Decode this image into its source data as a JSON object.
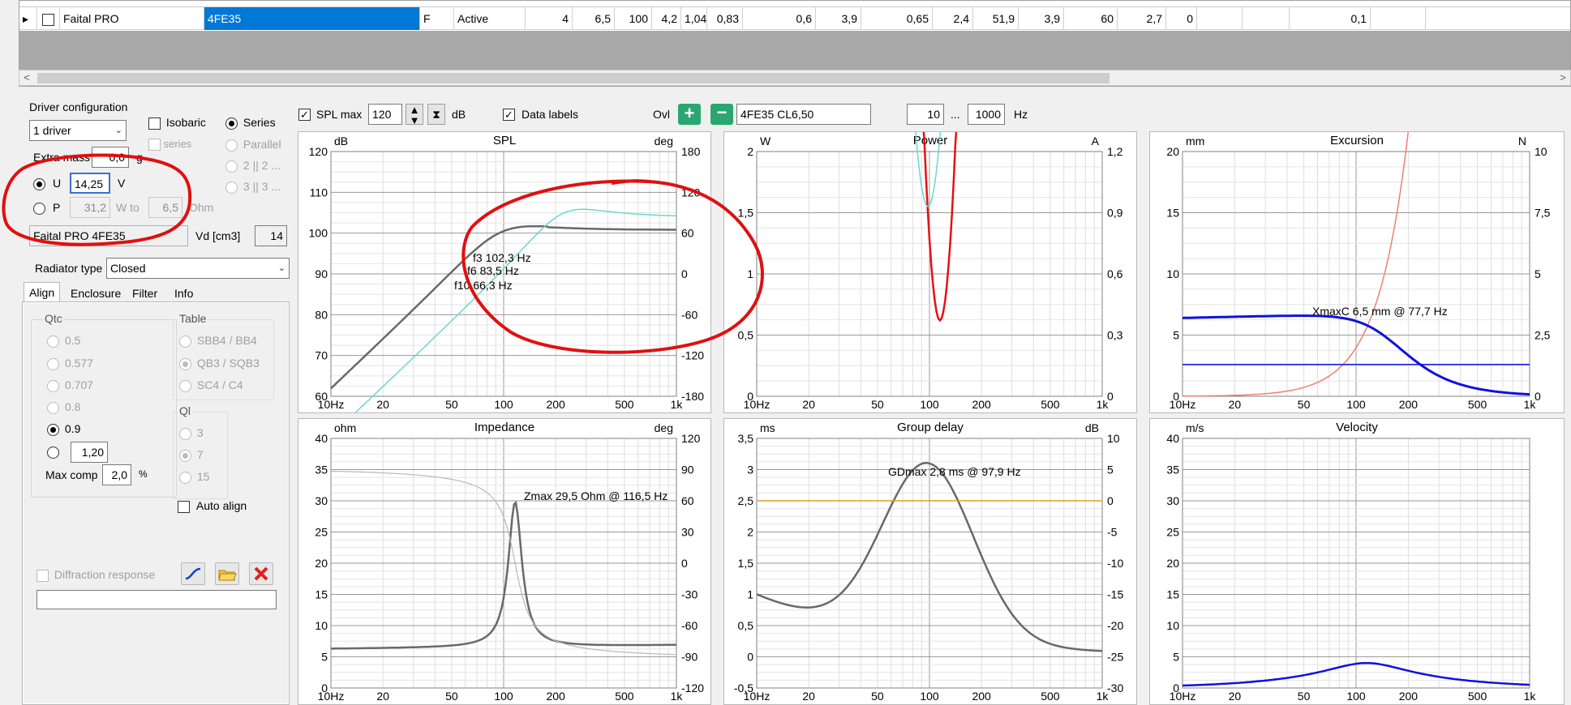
{
  "table": {
    "row": {
      "manufacturer": "Faital PRO",
      "model": "4FE35",
      "type": "F",
      "status": "Active",
      "values": [
        "4",
        "6,5",
        "100",
        "4,2",
        "1,04",
        "0,83",
        "0,6",
        "3,9",
        "0,65",
        "2,4",
        "51,9",
        "3,9",
        "60",
        "2,7",
        "0",
        "",
        "",
        "0,1",
        ""
      ]
    },
    "scroll_left": "<",
    "scroll_right": ">"
  },
  "driver_config": {
    "title": "Driver configuration",
    "count": "1 driver",
    "isobaric": "Isobaric",
    "series": "Series",
    "parallel": "Parallel",
    "series_small": "series",
    "opt22": "2 || 2 ...",
    "opt33": "3 || 3 ...",
    "extra_mass_label": "Extra mass",
    "extra_mass": "0,0",
    "extra_mass_unit": "g",
    "u_label": "U",
    "u_value": "14,25",
    "u_unit": "V",
    "p_label": "P",
    "p_value": "31,2",
    "p_unit": "W to",
    "ohm_value": "6,5",
    "ohm_unit": "Ohm",
    "driver_name": "Faital PRO 4FE35",
    "vd_label": "Vd [cm3]",
    "vd_value": "14"
  },
  "radiator": {
    "label": "Radiator type",
    "value": "Closed"
  },
  "tabs": [
    "Align",
    "Enclosure",
    "Filter",
    "Info"
  ],
  "align": {
    "qtc_title": "Qtc",
    "qtc_options": [
      "0.5",
      "0.577",
      "0.707",
      "0.8",
      "0.9"
    ],
    "qtc_custom": "1,20",
    "max_comp_label": "Max comp",
    "max_comp": "2,0",
    "max_comp_unit": "%",
    "table_title": "Table",
    "table_options": [
      "SBB4 / BB4",
      "QB3 / SQB3",
      "SC4 / C4"
    ],
    "ql_title": "Ql",
    "ql_options": [
      "3",
      "7",
      "15"
    ],
    "auto_align": "Auto align",
    "diffraction": "Diffraction response"
  },
  "toolbar": {
    "spl_max_label": "SPL max",
    "spl_max": "120",
    "db": "dB",
    "data_labels": "Data labels",
    "ovl": "Ovl",
    "curve_name": "4FE35 CL6,50",
    "f_from": "10",
    "ellipsis": "...",
    "f_to": "1000",
    "hz": "Hz"
  },
  "colors": {
    "grey_curve": "#696969",
    "cyan_curve": "#6ad8d0",
    "red_curve": "#e81010",
    "salmon_curve": "#f08070",
    "blue_curve": "#1010e0",
    "orange_line": "#e0a020",
    "annotation_red": "#e01010"
  },
  "x_ticks": [
    "10Hz",
    "20",
    "50",
    "100",
    "200",
    "500",
    "1k"
  ],
  "charts": {
    "spl": {
      "title": "SPL",
      "lunit": "dB",
      "runit": "deg",
      "left": [
        "120",
        "110",
        "100",
        "90",
        "80",
        "70",
        "60"
      ],
      "right": [
        "180",
        "120",
        "60",
        "0",
        "-60",
        "-120",
        "-180"
      ],
      "labels": [
        "f3 102,3 Hz",
        "f6 83,5 Hz",
        "f10 66,3 Hz"
      ]
    },
    "power": {
      "title": "Power",
      "lunit": "W",
      "runit": "A",
      "left": [
        "2",
        "1,5",
        "1",
        "0,5",
        "0"
      ],
      "right": [
        "1,2",
        "0,9",
        "0,6",
        "0,3",
        "0"
      ]
    },
    "excursion": {
      "title": "Excursion",
      "lunit": "mm",
      "runit": "N",
      "left": [
        "20",
        "15",
        "10",
        "5",
        "0"
      ],
      "right": [
        "10",
        "7,5",
        "5",
        "2,5",
        "0"
      ],
      "label": "XmaxC 6,5 mm  @ 77,7 Hz"
    },
    "impedance": {
      "title": "Impedance",
      "lunit": "ohm",
      "runit": "deg",
      "left": [
        "40",
        "35",
        "30",
        "25",
        "20",
        "15",
        "10",
        "5",
        "0"
      ],
      "right": [
        "120",
        "90",
        "60",
        "30",
        "0",
        "-30",
        "-60",
        "-90",
        "-120"
      ],
      "label": "Zmax 29,5 Ohm @ 116,5 Hz"
    },
    "group_delay": {
      "title": "Group delay",
      "lunit": "ms",
      "runit": "dB",
      "left": [
        "3,5",
        "3",
        "2,5",
        "2",
        "1,5",
        "1",
        "0,5",
        "0",
        "-0,5"
      ],
      "right": [
        "10",
        "5",
        "0",
        "-5",
        "-10",
        "-15",
        "-20",
        "-25",
        "-30"
      ],
      "label": "GDmax 2,8 ms  @ 97,9 Hz"
    },
    "velocity": {
      "title": "Velocity",
      "lunit": "m/s",
      "runit": "",
      "left": [
        "40",
        "35",
        "30",
        "25",
        "20",
        "15",
        "10",
        "5",
        "0"
      ],
      "right": []
    }
  }
}
